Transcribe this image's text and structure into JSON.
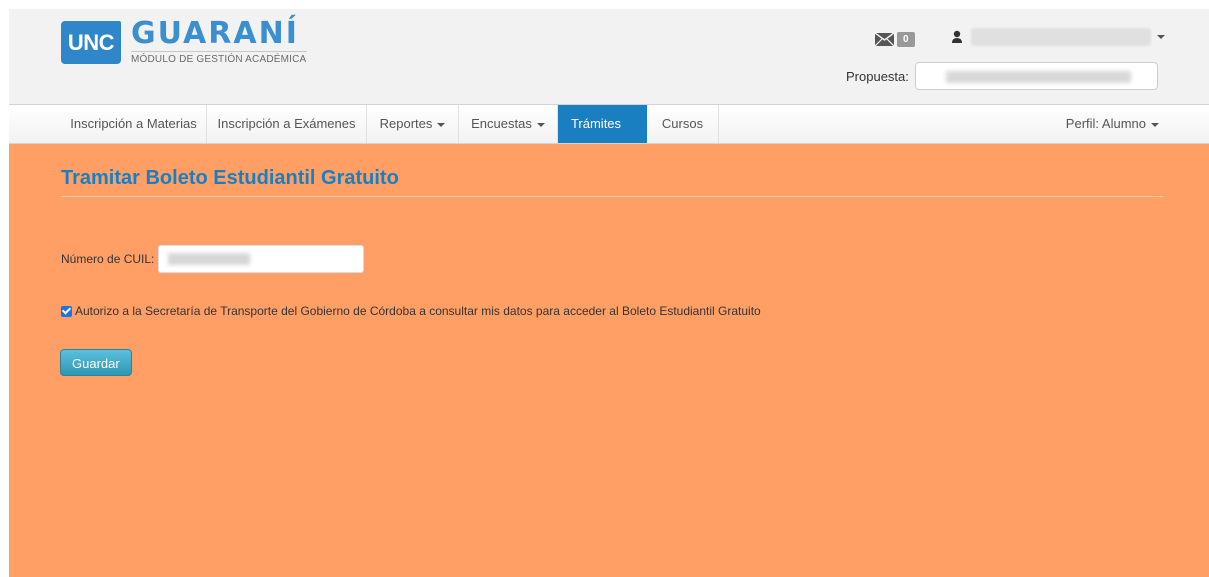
{
  "colors": {
    "accent": "#1a7fc0",
    "main_bg": "#ff9f65",
    "button": "#49afcd"
  },
  "header": {
    "logo_mark": "UNC",
    "logo_title": "GUARANÍ",
    "logo_subtitle": "MÓDULO DE GESTIÓN ACADÉMICA",
    "messages_count": "0",
    "propuesta_label": "Propuesta:"
  },
  "nav": {
    "items": [
      {
        "label": "Inscripción a Materias",
        "dropdown": false
      },
      {
        "label": "Inscripción a Exámenes",
        "dropdown": false
      },
      {
        "label": "Reportes",
        "dropdown": true
      },
      {
        "label": "Encuestas",
        "dropdown": true
      },
      {
        "label": "Trámites",
        "dropdown": true,
        "active": true
      },
      {
        "label": "Cursos",
        "dropdown": false
      }
    ],
    "perfil_label": "Perfil: Alumno"
  },
  "main": {
    "title": "Tramitar Boleto Estudiantil Gratuito",
    "cuil_label": "Número de CUIL:",
    "consent_text": "Autorizo a la Secretaría de Transporte del Gobierno de Córdoba a consultar mis datos para acceder al Boleto Estudiantil Gratuito",
    "consent_checked": true,
    "save_button": "Guardar"
  },
  "icons": {
    "mail": "envelope-icon",
    "user": "user-icon"
  }
}
